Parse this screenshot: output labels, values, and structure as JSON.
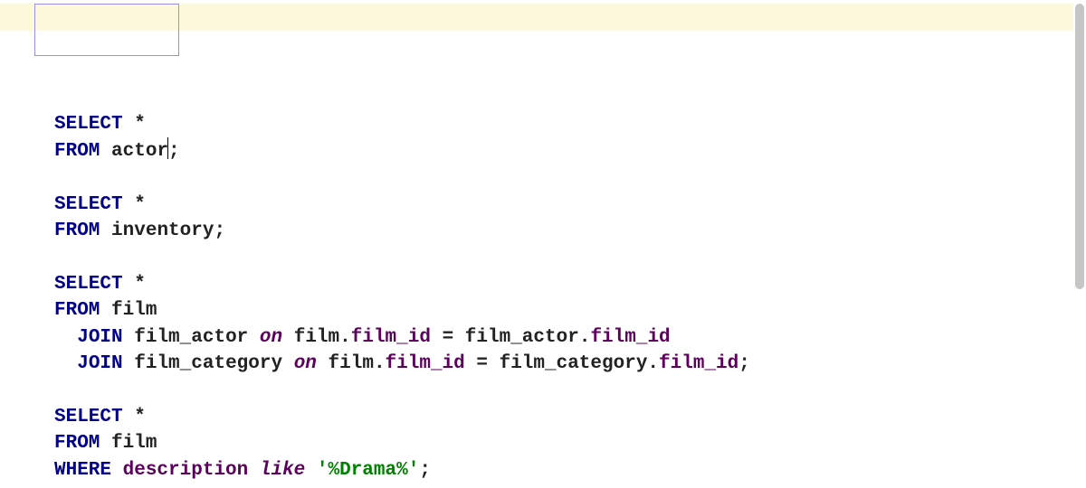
{
  "editor": {
    "highlight_line": 0,
    "cursor": {
      "line": 1,
      "after_token_index": 2
    },
    "lines": [
      [
        {
          "t": "SELECT",
          "c": "kw"
        },
        {
          "t": " "
        },
        {
          "t": "*",
          "c": "star"
        }
      ],
      [
        {
          "t": "FROM",
          "c": "kw"
        },
        {
          "t": " "
        },
        {
          "t": "actor",
          "c": "tbl"
        },
        {
          "t": ";",
          "c": "pun"
        }
      ],
      [],
      [
        {
          "t": "SELECT",
          "c": "kw"
        },
        {
          "t": " "
        },
        {
          "t": "*",
          "c": "star"
        }
      ],
      [
        {
          "t": "FROM",
          "c": "kw"
        },
        {
          "t": " "
        },
        {
          "t": "inventory",
          "c": "tbl"
        },
        {
          "t": ";",
          "c": "pun"
        }
      ],
      [],
      [
        {
          "t": "SELECT",
          "c": "kw"
        },
        {
          "t": " "
        },
        {
          "t": "*",
          "c": "star"
        }
      ],
      [
        {
          "t": "FROM",
          "c": "kw"
        },
        {
          "t": " "
        },
        {
          "t": "film",
          "c": "tbl"
        }
      ],
      [
        {
          "t": "  "
        },
        {
          "t": "JOIN",
          "c": "kw"
        },
        {
          "t": " "
        },
        {
          "t": "film_actor",
          "c": "tbl"
        },
        {
          "t": " "
        },
        {
          "t": "on",
          "c": "kw2"
        },
        {
          "t": " "
        },
        {
          "t": "film",
          "c": "tbl"
        },
        {
          "t": ".",
          "c": "pun"
        },
        {
          "t": "film_id",
          "c": "id"
        },
        {
          "t": " "
        },
        {
          "t": "=",
          "c": "op"
        },
        {
          "t": " "
        },
        {
          "t": "film_actor",
          "c": "tbl"
        },
        {
          "t": ".",
          "c": "pun"
        },
        {
          "t": "film_id",
          "c": "id"
        }
      ],
      [
        {
          "t": "  "
        },
        {
          "t": "JOIN",
          "c": "kw"
        },
        {
          "t": " "
        },
        {
          "t": "film_category",
          "c": "tbl"
        },
        {
          "t": " "
        },
        {
          "t": "on",
          "c": "kw2"
        },
        {
          "t": " "
        },
        {
          "t": "film",
          "c": "tbl"
        },
        {
          "t": ".",
          "c": "pun"
        },
        {
          "t": "film_id",
          "c": "id"
        },
        {
          "t": " "
        },
        {
          "t": "=",
          "c": "op"
        },
        {
          "t": " "
        },
        {
          "t": "film_category",
          "c": "tbl"
        },
        {
          "t": ".",
          "c": "pun"
        },
        {
          "t": "film_id",
          "c": "id"
        },
        {
          "t": ";",
          "c": "pun"
        }
      ],
      [],
      [
        {
          "t": "SELECT",
          "c": "kw"
        },
        {
          "t": " "
        },
        {
          "t": "*",
          "c": "star"
        }
      ],
      [
        {
          "t": "FROM",
          "c": "kw"
        },
        {
          "t": " "
        },
        {
          "t": "film",
          "c": "tbl"
        }
      ],
      [
        {
          "t": "WHERE",
          "c": "kw"
        },
        {
          "t": " "
        },
        {
          "t": "description",
          "c": "id"
        },
        {
          "t": " "
        },
        {
          "t": "like",
          "c": "kw2"
        },
        {
          "t": " "
        },
        {
          "t": "'%Drama%'",
          "c": "str"
        },
        {
          "t": ";",
          "c": "pun"
        }
      ]
    ]
  }
}
